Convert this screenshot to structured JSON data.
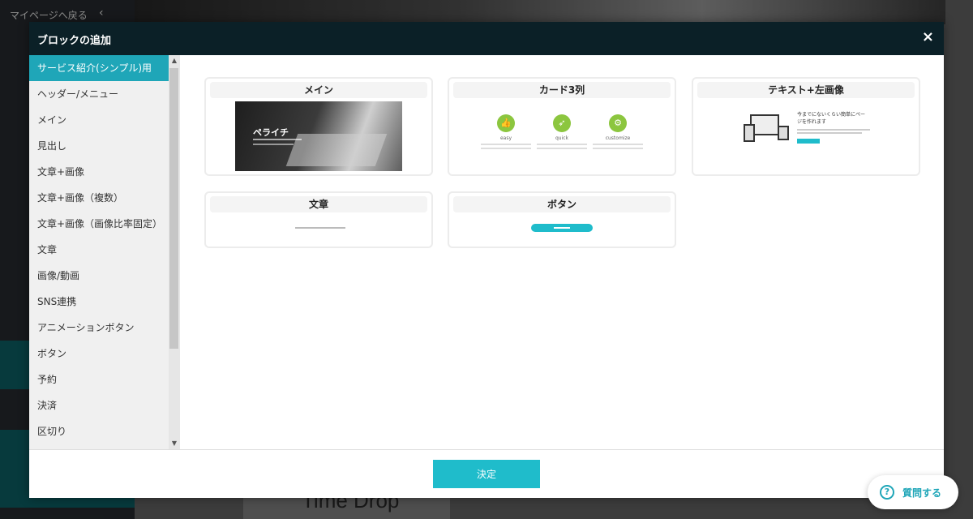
{
  "background": {
    "back_link": "マイページへ戻る",
    "page_heading": "Time Drop"
  },
  "modal": {
    "title": "ブロックの追加",
    "close_icon": "×",
    "categories": [
      "サービス紹介(シンプル)用",
      "ヘッダー/メニュー",
      "メイン",
      "見出し",
      "文章+画像",
      "文章+画像（複数）",
      "文章+画像（画像比率固定）",
      "文章",
      "画像/動画",
      "SNS連携",
      "アニメーションボタン",
      "ボタン",
      "予約",
      "決済",
      "区切り"
    ],
    "active_category": "サービス紹介(シンプル)用",
    "blocks": [
      {
        "title": "メイン",
        "preview_brand": "ペライチ"
      },
      {
        "title": "カード3列",
        "labels": [
          "easy",
          "quick",
          "customize"
        ]
      },
      {
        "title": "テキスト+左画像",
        "preview_heading": "今までにないくらい簡単にページを作れます"
      },
      {
        "title": "文章"
      },
      {
        "title": "ボタン"
      }
    ],
    "confirm_label": "決定"
  },
  "help": {
    "icon": "?",
    "label": "質問する"
  },
  "colors": {
    "accent": "#1fbccb",
    "header": "#0b2027",
    "active_item": "#1fa6b8",
    "card_icon": "#8cc63f"
  }
}
